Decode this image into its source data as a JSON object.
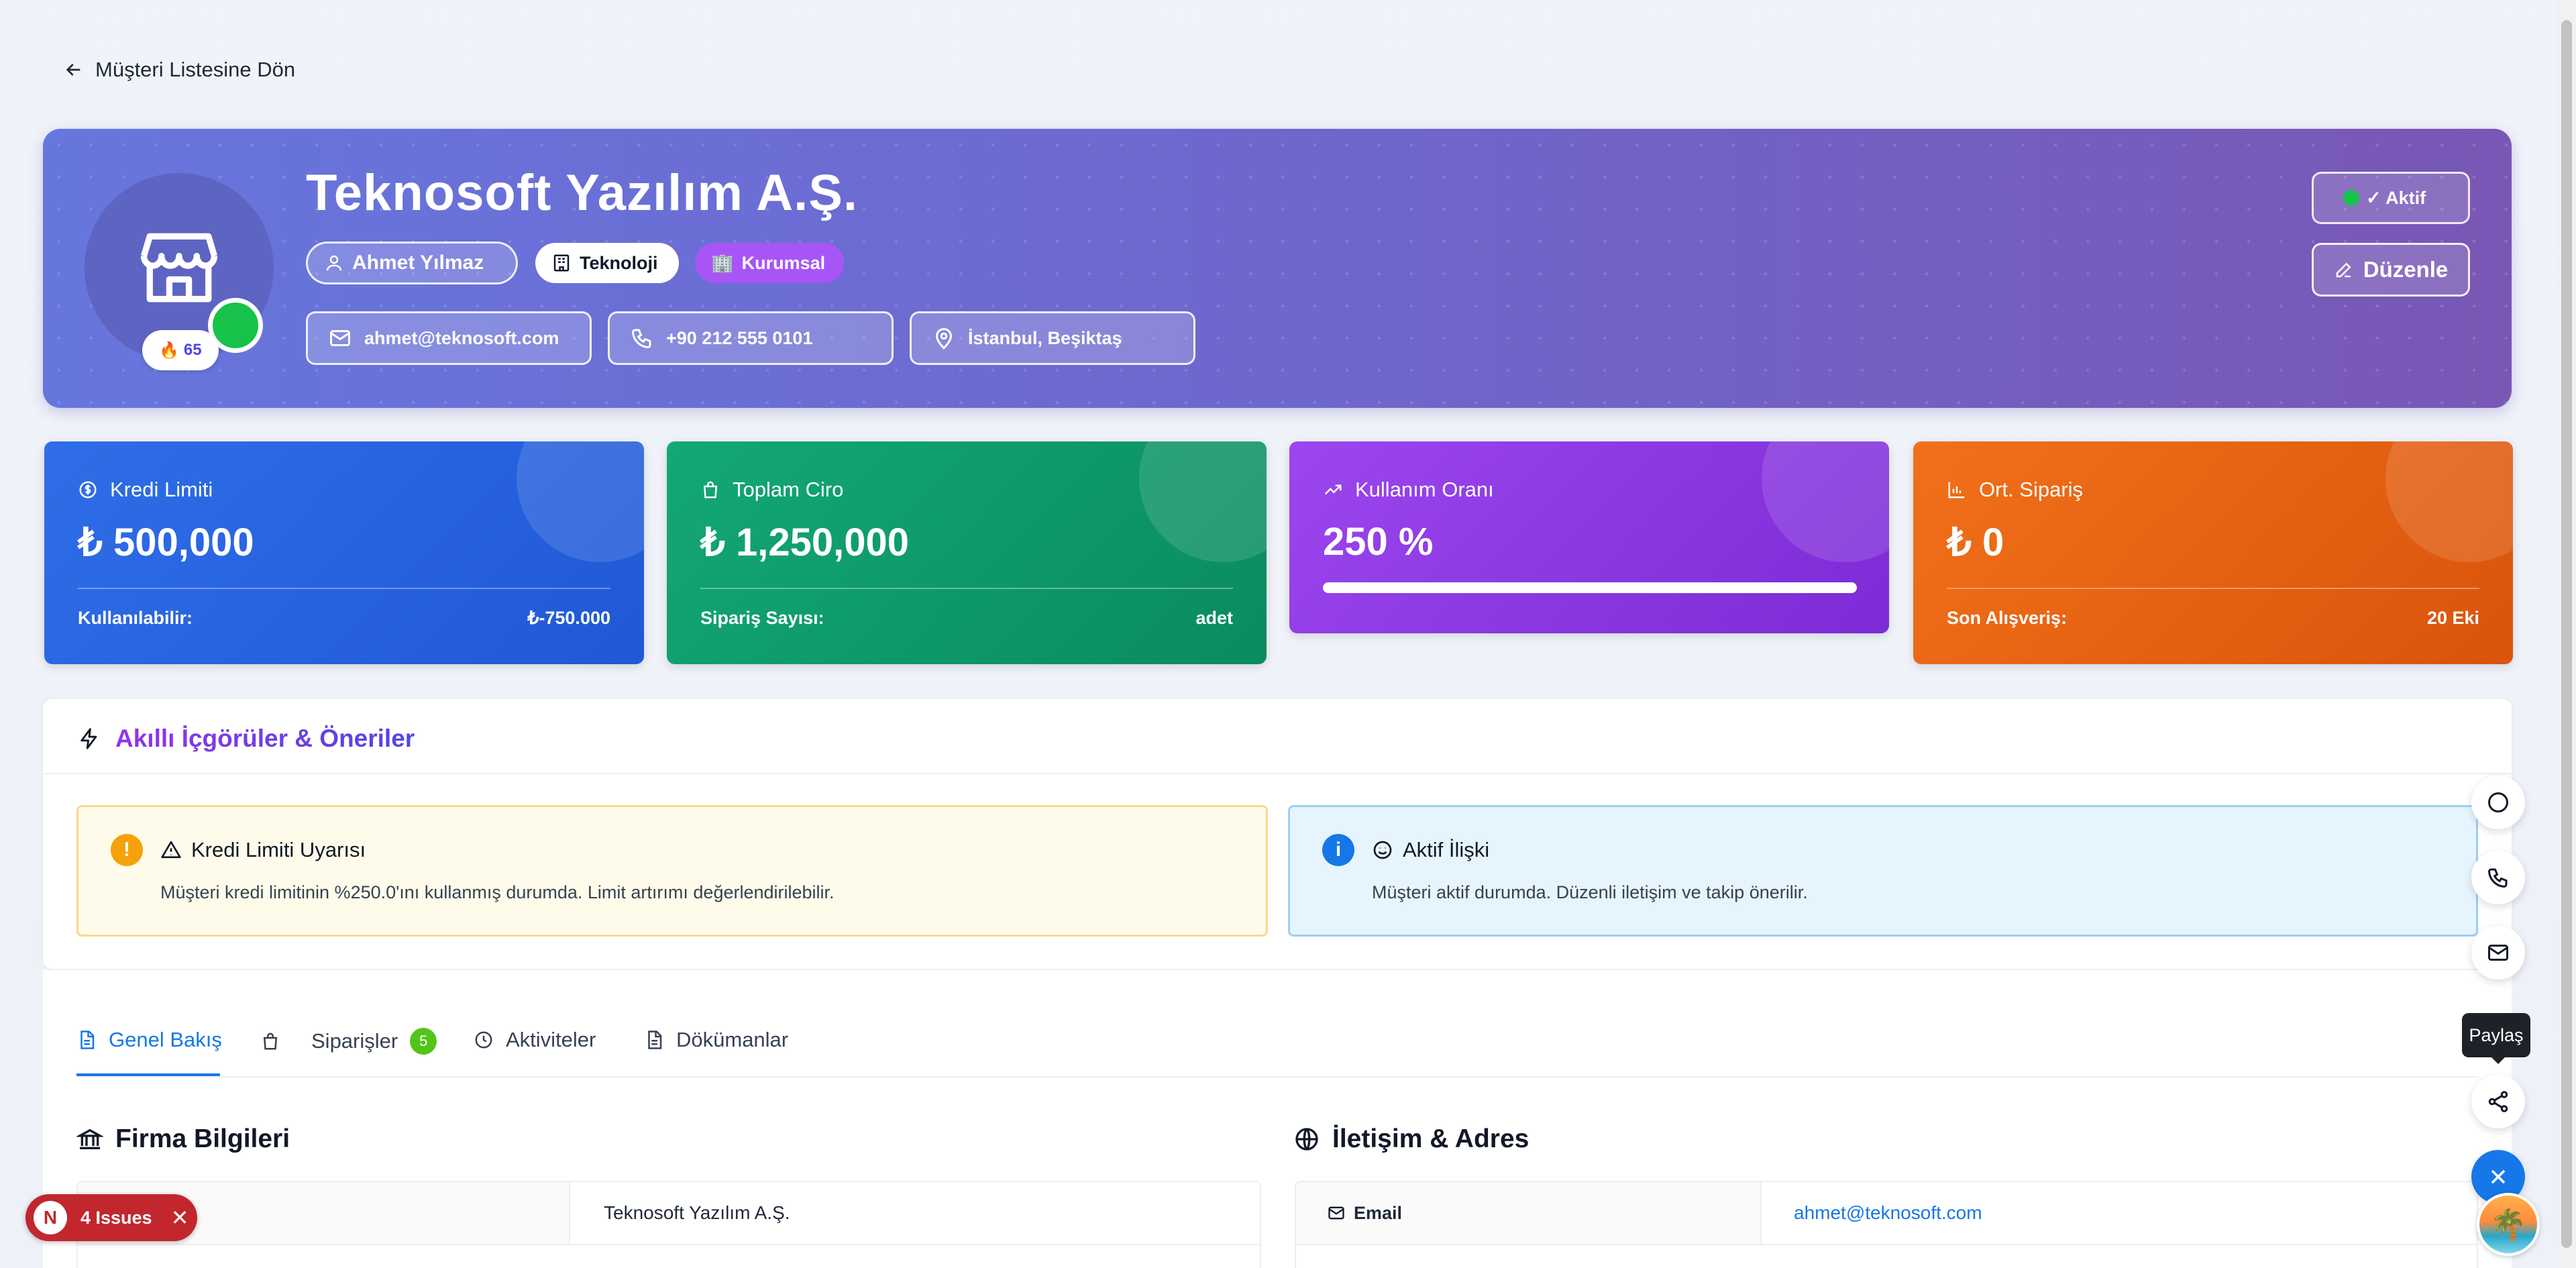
{
  "back_link": {
    "label": "Müşteri Listesine Dön"
  },
  "customer": {
    "name": "Teknosoft Yazılım A.Ş.",
    "score": "65",
    "owner": "Ahmet Yılmaz",
    "sector": "Teknoloji",
    "type": "Kurumsal",
    "email": "ahmet@teknosoft.com",
    "phone": "+90 212 555 0101",
    "location": "İstanbul, Beşiktaş",
    "status": "✓ Aktif",
    "edit_label": "Düzenle"
  },
  "stats": [
    {
      "title": "Kredi Limiti",
      "value": "₺ 500,000",
      "foot_label": "Kullanılabilir:",
      "foot_value": "₺-750.000",
      "icon": "dollar-circle-icon"
    },
    {
      "title": "Toplam Ciro",
      "value": "₺ 1,250,000",
      "foot_label": "Sipariş Sayısı:",
      "foot_value": "adet",
      "icon": "shopping-bag-icon"
    },
    {
      "title": "Kullanım Oranı",
      "value": "250 %",
      "progress": 1.0,
      "icon": "trend-up-icon"
    },
    {
      "title": "Ort. Sipariş",
      "value": "₺ 0",
      "foot_label": "Son Alışveriş:",
      "foot_value": "20 Eki",
      "icon": "bar-chart-icon"
    }
  ],
  "insights": {
    "title": "Akıllı İçgörüler & Öneriler",
    "alerts": [
      {
        "title": "Kredi Limiti Uyarısı",
        "text": "Müşteri kredi limitinin %250.0'ını kullanmış durumda. Limit artırımı değerlendirilebilir.",
        "icon_glyph": "!"
      },
      {
        "title": "Aktif İlişki",
        "text": "Müşteri aktif durumda. Düzenli iletişim ve takip önerilir.",
        "icon_glyph": "i"
      }
    ]
  },
  "tabs": [
    {
      "label": "Genel Bakış"
    },
    {
      "label": "Siparişler",
      "count": "5"
    },
    {
      "label": "Aktiviteler"
    },
    {
      "label": "Dökümanlar"
    }
  ],
  "company_info": {
    "title": "Firma Bilgileri",
    "first_value": "Teknosoft Yazılım A.Ş."
  },
  "contact_info": {
    "title": "İletişim & Adres",
    "email_label": "Email",
    "email_value": "ahmet@teknosoft.com"
  },
  "floating": {
    "tooltip": "Paylaş"
  },
  "issues": {
    "badge_letter": "N",
    "label": "4 Issues"
  },
  "colors": {
    "accent": "#1677e8",
    "hero_start": "#6776dd",
    "hero_end": "#7957b5",
    "success": "#16c24a"
  }
}
